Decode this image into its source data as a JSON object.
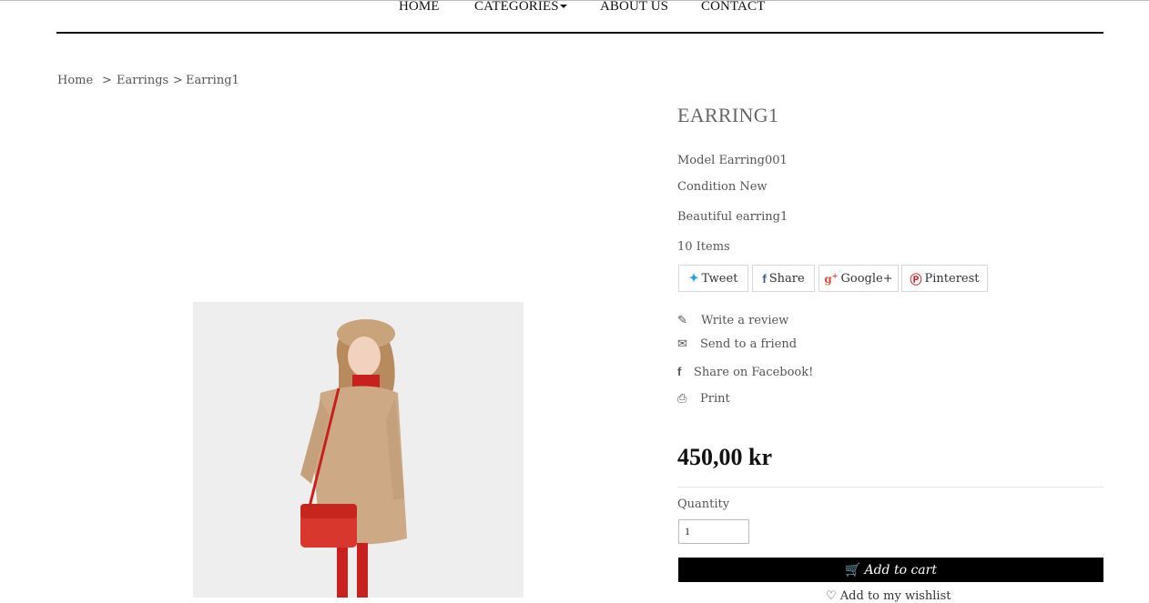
{
  "nav": {
    "home": "HOME",
    "categories": "CATEGORIES",
    "about": "ABOUT US",
    "contact": "CONTACT"
  },
  "breadcrumb": {
    "sep": ">",
    "items": [
      "Home",
      "Earrings",
      "Earring1"
    ]
  },
  "product": {
    "title": "EARRING1",
    "model": "Model Earring001",
    "condition": "Condition New",
    "description": "Beautiful earring1",
    "stock": "10 Items",
    "price": "450,00 kr"
  },
  "share": {
    "tweet": "Tweet",
    "share": "Share",
    "google": "Google+",
    "pinterest": "Pinterest",
    "icons": [
      "twitter-icon",
      "facebook-icon",
      "google-plus-icon",
      "pinterest-icon"
    ]
  },
  "actions": {
    "review": "Write a review",
    "friend": "Send to a friend",
    "facebook": "Share on Facebook!",
    "print": "Print"
  },
  "purchase": {
    "quantity_label": "Quantity",
    "quantity_value": "1",
    "add_to_cart": "Add to cart",
    "wishlist": "Add to my wishlist"
  },
  "colors": {
    "twitter": "#1da1f2",
    "facebook": "#3b5998",
    "google": "#dd4b39",
    "pinterest": "#cb2027",
    "button": "#000000"
  }
}
